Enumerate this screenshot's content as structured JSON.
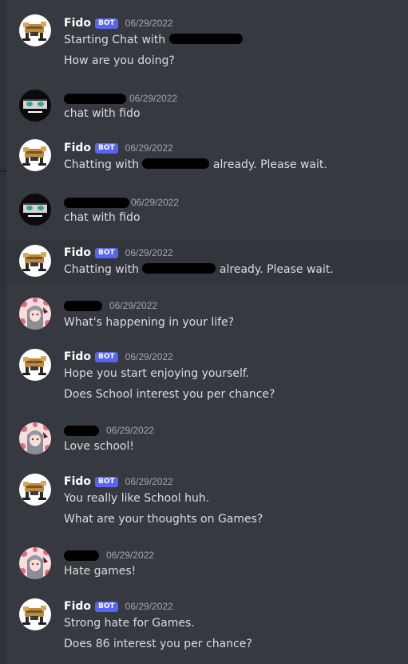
{
  "colors": {
    "background": "#36393f",
    "highlight": "#32353b",
    "bot_tag": "#5865f2",
    "username": "#ffffff",
    "message_text": "#dcddde",
    "timestamp": "#a3a6aa"
  },
  "messages": [
    {
      "author": "Fido",
      "bot_tag": "BOT",
      "timestamp": "06/29/2022",
      "avatar": "fido-avatar-icon",
      "lines": [
        {
          "before": "Starting Chat with ",
          "after": ""
        },
        {
          "text": "How are you doing?"
        }
      ]
    },
    {
      "author": "",
      "timestamp": "06/29/2022",
      "avatar": "anime-eyes-avatar-icon",
      "lines": [
        {
          "text": "chat with fido"
        }
      ]
    },
    {
      "author": "Fido",
      "bot_tag": "BOT",
      "timestamp": "06/29/2022",
      "avatar": "fido-avatar-icon",
      "lines": [
        {
          "before": "Chatting with ",
          "after": " already. Please wait."
        }
      ]
    },
    {
      "author": "",
      "timestamp": "06/29/2022",
      "avatar": "anime-eyes-avatar-icon",
      "lines": [
        {
          "text": "chat with fido"
        }
      ]
    },
    {
      "author": "Fido",
      "bot_tag": "BOT",
      "timestamp": "06/29/2022",
      "avatar": "fido-avatar-icon",
      "lines": [
        {
          "before": "Chatting with ",
          "after": " already. Please wait."
        }
      ]
    },
    {
      "author": "",
      "timestamp": "06/29/2022",
      "avatar": "anime-girl-avatar-icon",
      "lines": [
        {
          "text": "What's happening in your life?"
        }
      ]
    },
    {
      "author": "Fido",
      "bot_tag": "BOT",
      "timestamp": "06/29/2022",
      "avatar": "fido-avatar-icon",
      "lines": [
        {
          "text": "Hope you start enjoying yourself."
        },
        {
          "text": "Does School interest you per chance?"
        }
      ]
    },
    {
      "author": "",
      "timestamp": "06/29/2022",
      "avatar": "anime-girl-avatar-icon",
      "lines": [
        {
          "text": "Love school!"
        }
      ]
    },
    {
      "author": "Fido",
      "bot_tag": "BOT",
      "timestamp": "06/29/2022",
      "avatar": "fido-avatar-icon",
      "lines": [
        {
          "text": "You really like School huh."
        },
        {
          "text": "What are your thoughts on Games?"
        }
      ]
    },
    {
      "author": "",
      "timestamp": "06/29/2022",
      "avatar": "anime-girl-avatar-icon",
      "lines": [
        {
          "text": "Hate games!"
        }
      ]
    },
    {
      "author": "Fido",
      "bot_tag": "BOT",
      "timestamp": "06/29/2022",
      "avatar": "fido-avatar-icon",
      "lines": [
        {
          "text": "Strong hate for Games."
        },
        {
          "text": "Does 86 interest you per chance?"
        }
      ]
    }
  ]
}
